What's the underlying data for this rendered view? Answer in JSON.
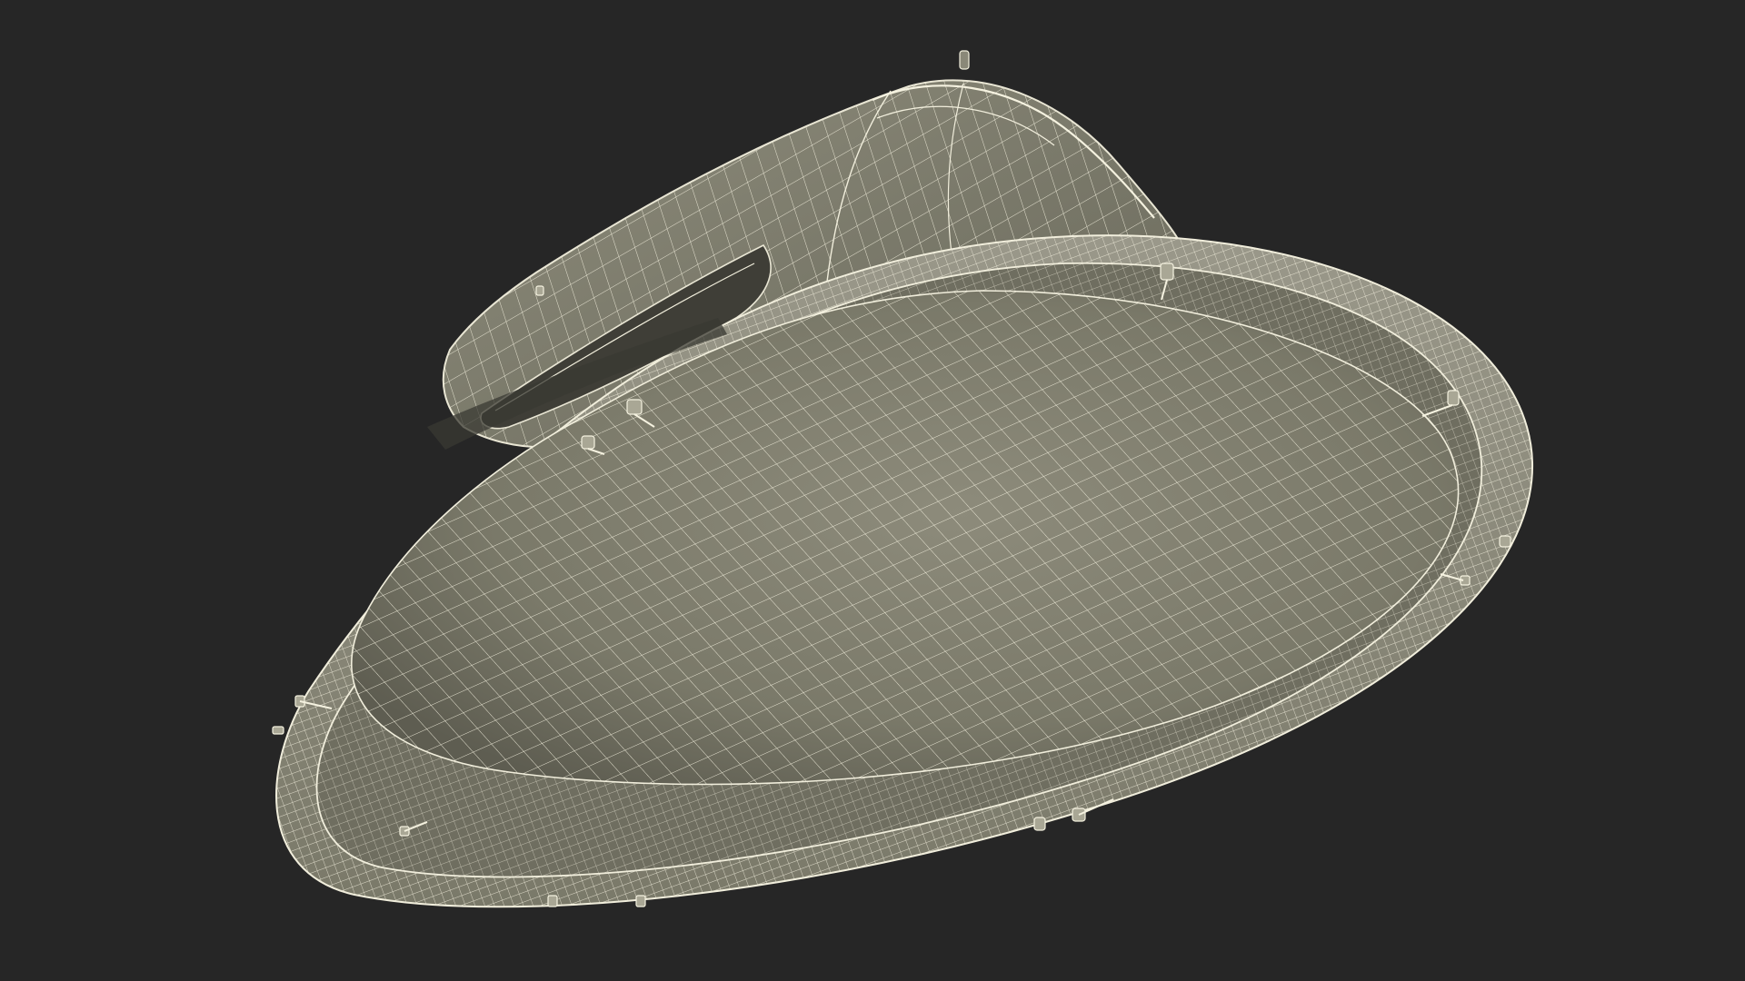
{
  "scene": {
    "subject_icon": "wireframe-3d-model-icon",
    "colors": {
      "background": "#262626",
      "surface": "#7e7d6e",
      "surface_light": "#989685",
      "surface_dark": "#5f5e52",
      "rim": "#8a8978",
      "wire": "#f1eedc",
      "shadow": "#2c2b27"
    }
  }
}
